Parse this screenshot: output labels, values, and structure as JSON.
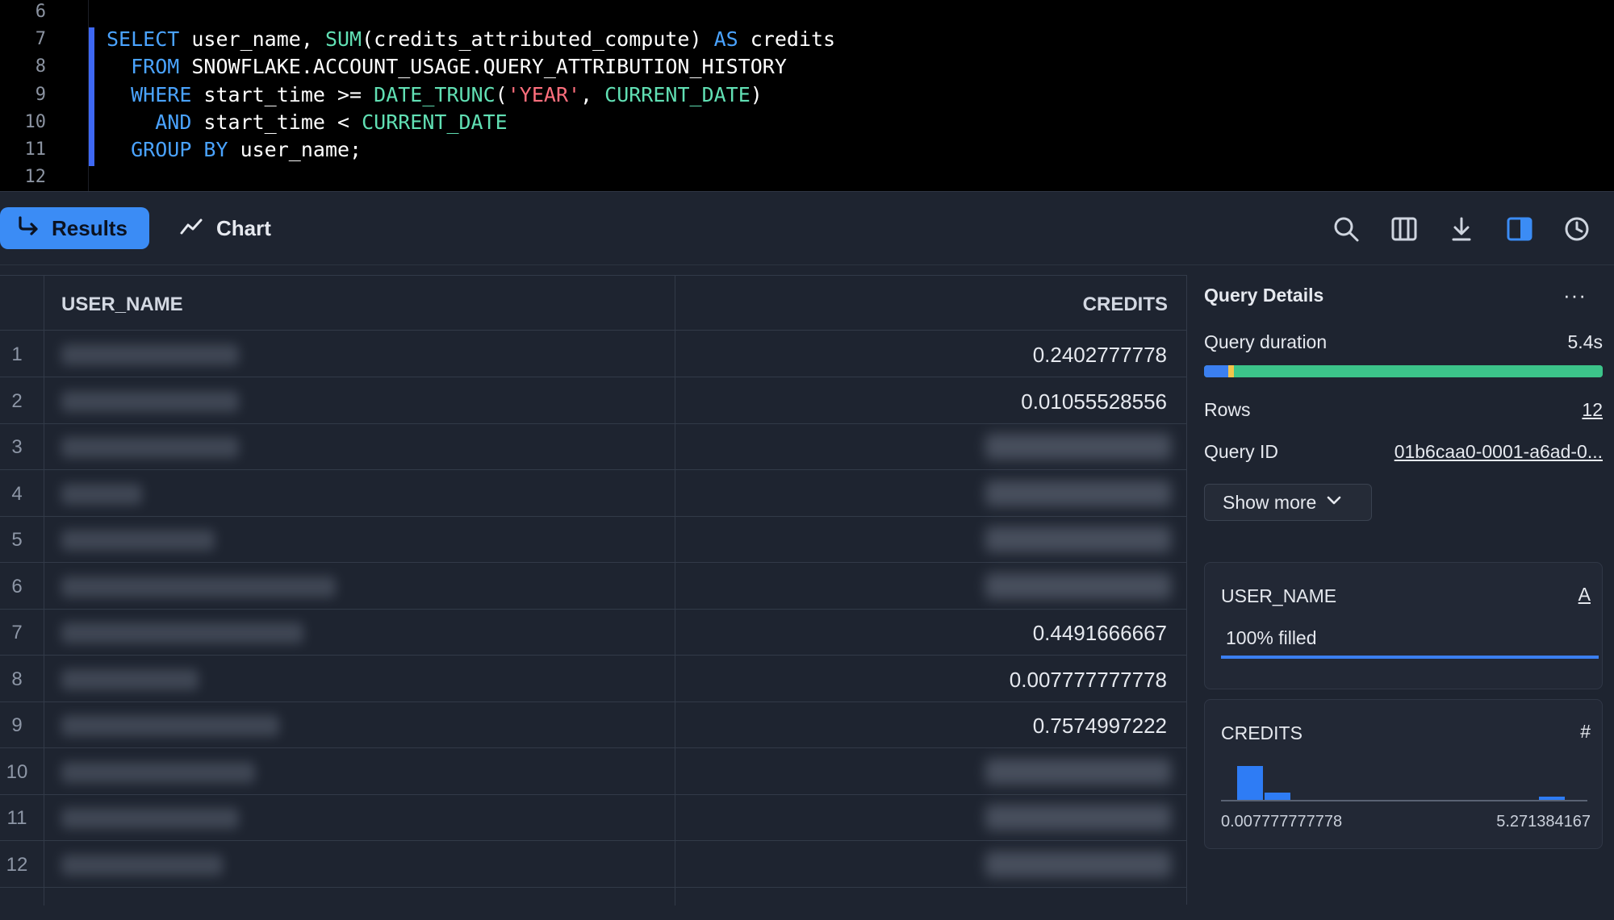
{
  "editor": {
    "line_numbers": [
      "6",
      "7",
      "8",
      "9",
      "10",
      "11",
      "12"
    ],
    "lines": [
      [],
      [
        {
          "t": "SELECT",
          "c": "kw"
        },
        {
          "t": " user_name, ",
          "c": ""
        },
        {
          "t": "SUM",
          "c": "fn"
        },
        {
          "t": "(credits_attributed_compute) ",
          "c": ""
        },
        {
          "t": "AS",
          "c": "kw"
        },
        {
          "t": " credits",
          "c": ""
        }
      ],
      [
        {
          "t": "  ",
          "c": ""
        },
        {
          "t": "FROM",
          "c": "kw"
        },
        {
          "t": " SNOWFLAKE.ACCOUNT_USAGE.QUERY_ATTRIBUTION_HISTORY",
          "c": ""
        }
      ],
      [
        {
          "t": "  ",
          "c": ""
        },
        {
          "t": "WHERE",
          "c": "kw"
        },
        {
          "t": " start_time >= ",
          "c": ""
        },
        {
          "t": "DATE_TRUNC",
          "c": "fn"
        },
        {
          "t": "(",
          "c": ""
        },
        {
          "t": "'YEAR'",
          "c": "str"
        },
        {
          "t": ", ",
          "c": ""
        },
        {
          "t": "CURRENT_DATE",
          "c": "fn"
        },
        {
          "t": ")",
          "c": ""
        }
      ],
      [
        {
          "t": "    ",
          "c": ""
        },
        {
          "t": "AND",
          "c": "kw"
        },
        {
          "t": " start_time < ",
          "c": ""
        },
        {
          "t": "CURRENT_DATE",
          "c": "fn"
        }
      ],
      [
        {
          "t": "  ",
          "c": ""
        },
        {
          "t": "GROUP BY",
          "c": "kw"
        },
        {
          "t": " user_name;",
          "c": ""
        }
      ],
      []
    ]
  },
  "toolbar": {
    "results_label": "Results",
    "chart_label": "Chart",
    "icons": [
      "search-icon",
      "columns-icon",
      "download-icon",
      "panel-toggle-icon",
      "history-icon"
    ]
  },
  "table": {
    "columns": [
      "USER_NAME",
      "CREDITS"
    ],
    "rows": [
      {
        "num": "1",
        "credits": "0.2402777778",
        "blurred": false
      },
      {
        "num": "2",
        "credits": "0.01055528556",
        "blurred": false
      },
      {
        "num": "3",
        "credits": "",
        "blurred": true
      },
      {
        "num": "4",
        "credits": "",
        "blurred": true
      },
      {
        "num": "5",
        "credits": "",
        "blurred": true
      },
      {
        "num": "6",
        "credits": "",
        "blurred": true
      },
      {
        "num": "7",
        "credits": "0.4491666667",
        "blurred": false
      },
      {
        "num": "8",
        "credits": "0.007777777778",
        "blurred": false
      },
      {
        "num": "9",
        "credits": "0.7574997222",
        "blurred": false
      },
      {
        "num": "10",
        "credits": "",
        "blurred": true
      },
      {
        "num": "11",
        "credits": "",
        "blurred": true
      },
      {
        "num": "12",
        "credits": "",
        "blurred": true
      }
    ]
  },
  "details": {
    "title": "Query Details",
    "more": "···",
    "duration_label": "Query duration",
    "duration_value": "5.4s",
    "duration_segments": [
      {
        "fraction": 0.06,
        "color": "#3b7ff0"
      },
      {
        "fraction": 0.015,
        "color": "#f3c44b"
      },
      {
        "fraction": 0.925,
        "color": "#3cc48a"
      }
    ],
    "rows_label": "Rows",
    "rows_value": "12",
    "query_id_label": "Query ID",
    "query_id_value": "01b6caa0-0001-a6ad-0...",
    "show_more": "Show more"
  },
  "stats": {
    "user_name": {
      "title": "USER_NAME",
      "type_glyph": "A",
      "fill_text": "100% filled",
      "fill_fraction": 1.0
    },
    "credits": {
      "title": "CREDITS",
      "type_glyph": "#",
      "min": "0.007777777778",
      "max": "5.271384167",
      "histogram": [
        1.0,
        0.22,
        0,
        0,
        0,
        0,
        0,
        0,
        0,
        0,
        0,
        0.08,
        0
      ]
    }
  },
  "colors": {
    "accent": "#3b8cf5",
    "keyword": "#4aa3ff",
    "function": "#61e0b4",
    "string": "#ff6f7d"
  }
}
